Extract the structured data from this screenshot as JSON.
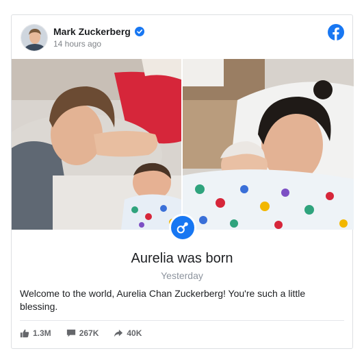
{
  "post": {
    "author_name": "Mark Zuckerberg",
    "timestamp": "14 hours ago",
    "icons": {
      "avatar": "profile-photo",
      "verified": "verified-badge-icon",
      "platform": "facebook-logo-icon",
      "event": "baby-pacifier-icon"
    },
    "event_title": "Aurelia was born",
    "event_date": "Yesterday",
    "caption": "Welcome to the world, Aurelia Chan Zuckerberg! You're such a little blessing.",
    "stats": {
      "likes": "1.3M",
      "comments": "267K",
      "shares": "40K"
    }
  },
  "colors": {
    "brand_blue": "#1877f2",
    "text_primary": "#1c1e21",
    "text_secondary": "#8d949e"
  }
}
